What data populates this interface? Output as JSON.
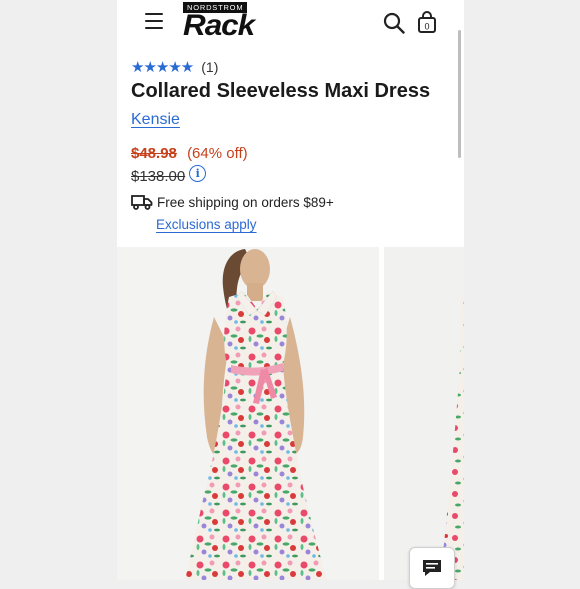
{
  "header": {
    "logo_top": "NORDSTROM",
    "logo_main": "Rack"
  },
  "product": {
    "stars": "★★★★★",
    "review_count": "(1)",
    "title": "Collared Sleeveless Maxi Dress",
    "brand": "Kensie",
    "sale_price": "$48.98",
    "discount": "(64% off)",
    "original_price": "$138.00"
  },
  "shipping": {
    "text": "Free shipping on orders $89+",
    "exclusions_link": "Exclusions apply"
  },
  "colors": {
    "accent_blue": "#2a6ad3",
    "sale_red": "#c6401c"
  },
  "icons": [
    "menu-icon",
    "search-icon",
    "bag-icon",
    "info-icon",
    "truck-icon",
    "chat-icon"
  ]
}
